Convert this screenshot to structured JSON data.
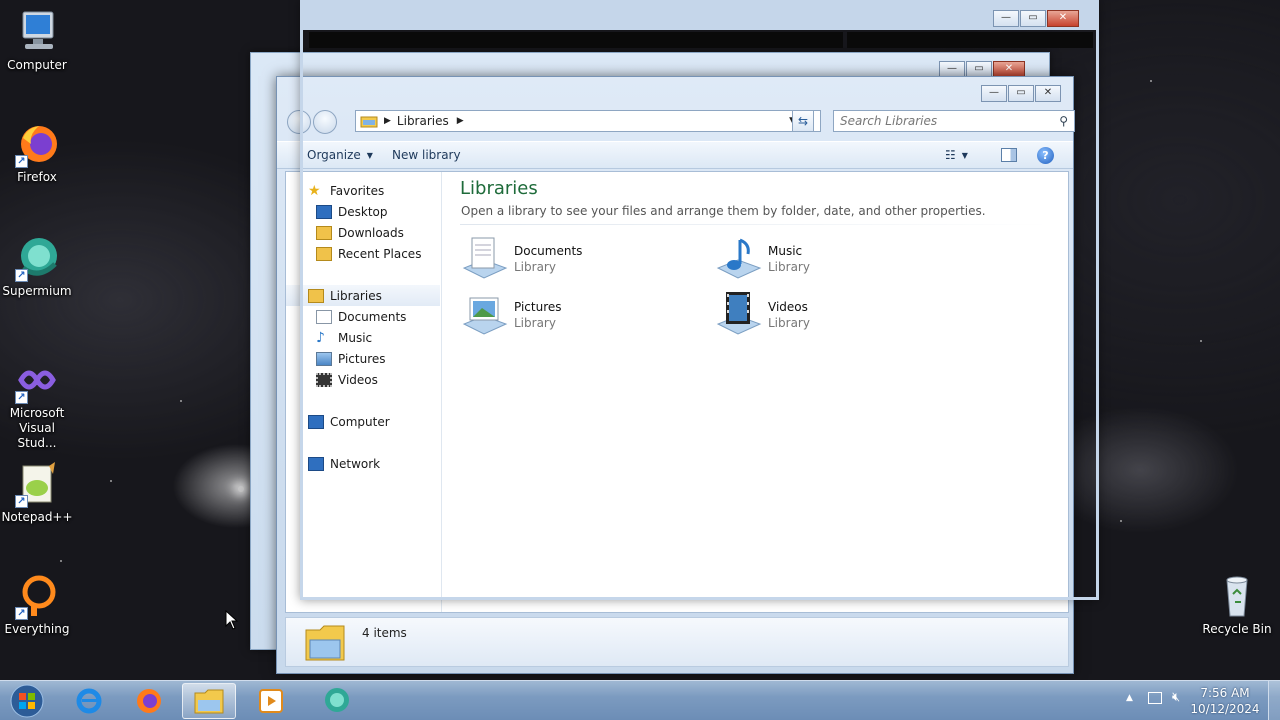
{
  "desktop": {
    "icons": [
      {
        "label": "Computer"
      },
      {
        "label": "Firefox"
      },
      {
        "label": "Supermium"
      },
      {
        "label": "Microsoft Visual Stud..."
      },
      {
        "label": "Notepad++"
      },
      {
        "label": "Everything"
      },
      {
        "label": "Recycle Bin"
      }
    ]
  },
  "explorer": {
    "breadcrumb": "Libraries",
    "search_placeholder": "Search Libraries",
    "toolbar": {
      "organize": "Organize",
      "new_library": "New library"
    },
    "nav": {
      "favorites": {
        "label": "Favorites",
        "items": [
          "Desktop",
          "Downloads",
          "Recent Places"
        ]
      },
      "libraries": {
        "label": "Libraries",
        "items": [
          "Documents",
          "Music",
          "Pictures",
          "Videos"
        ]
      },
      "computer": "Computer",
      "network": "Network"
    },
    "pane": {
      "title": "Libraries",
      "description": "Open a library to see your files and arrange them by folder, date, and other properties."
    },
    "libraries": [
      {
        "name": "Documents",
        "type": "Library"
      },
      {
        "name": "Music",
        "type": "Library"
      },
      {
        "name": "Pictures",
        "type": "Library"
      },
      {
        "name": "Videos",
        "type": "Library"
      }
    ],
    "status": "4 items"
  },
  "taskbar": {
    "time": "7:56 AM",
    "date": "10/12/2024"
  }
}
